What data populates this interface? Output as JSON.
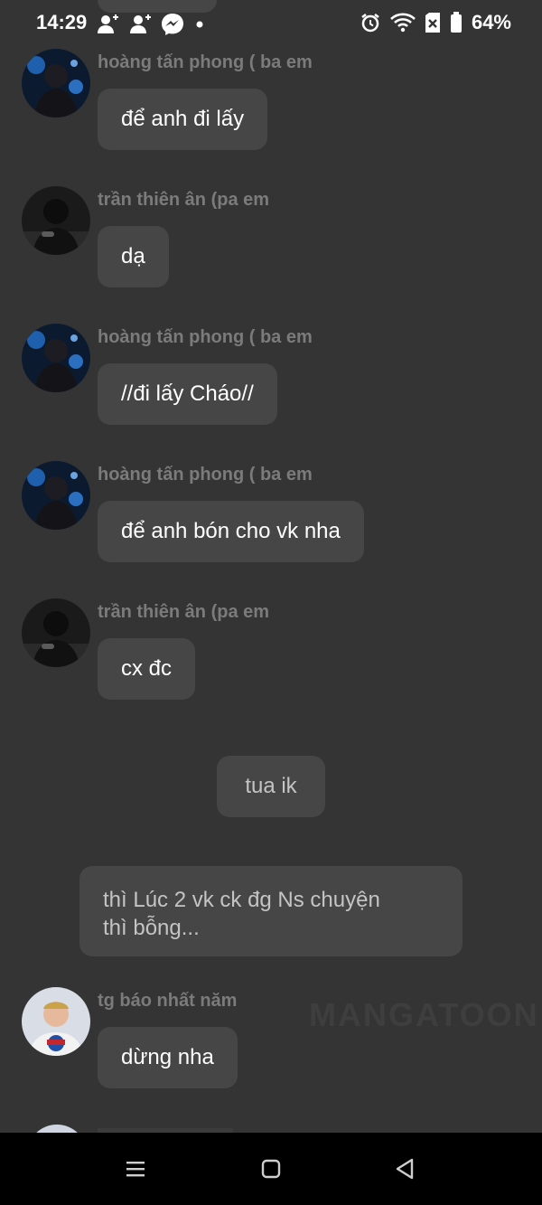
{
  "status_bar": {
    "time": "14:29",
    "battery": "64%"
  },
  "messages": [
    {
      "sender": "hoàng tấn phong ( ba em",
      "text": "để anh đi lấy",
      "avatar": "phong"
    },
    {
      "sender": "trần thiên ân (pa em",
      "text": "dạ",
      "avatar": "an"
    },
    {
      "sender": "hoàng tấn phong ( ba em",
      "text": "//đi lấy Cháo//",
      "avatar": "phong"
    },
    {
      "sender": "hoàng tấn phong ( ba em",
      "text": "để anh bón cho vk nha",
      "avatar": "phong"
    },
    {
      "sender": "trần thiên ân (pa em",
      "text": "cx đc",
      "avatar": "an"
    }
  ],
  "narration": [
    {
      "text": "tua ik"
    },
    {
      "line1": "thì Lúc 2 vk ck đg Ns chuyện",
      "line2": "thì bỗng..."
    }
  ],
  "last_message": {
    "sender": "tg báo nhất năm",
    "text": "dừng nha"
  },
  "watermark": "MANGATOON",
  "colors": {
    "background": "#343434",
    "bubble": "#464646",
    "sender": "#7b7b7b",
    "nav_bar": "#000000"
  }
}
